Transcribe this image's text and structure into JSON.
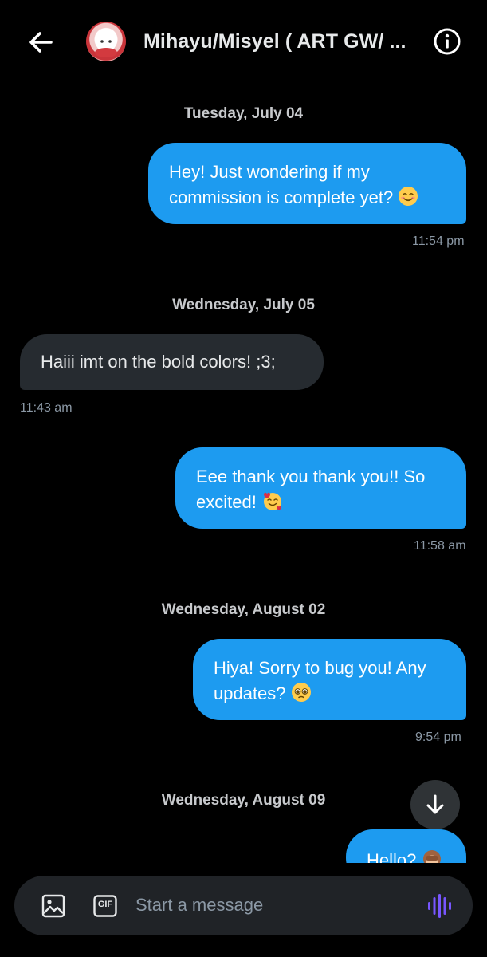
{
  "header": {
    "title": "Mihayu/Misyel ( ART GW/ ..."
  },
  "dates": {
    "d1": "Tuesday, July 04",
    "d2": "Wednesday, July 05",
    "d3": "Wednesday, August 02",
    "d4": "Wednesday, August 09"
  },
  "messages": [
    {
      "type": "sent",
      "text": "Hey! Just wondering if my commission is complete yet?",
      "emoji": "smiling-face-icon",
      "time": "11:54 pm"
    },
    {
      "type": "received",
      "text": "Haiii imt on the bold colors! ;3;",
      "time": "11:43 am"
    },
    {
      "type": "sent",
      "text": "Eee thank you thank you!! So excited!",
      "emoji": "smiling-face-with-hearts-icon",
      "time": "11:58 am"
    },
    {
      "type": "sent",
      "text": "Hiya! Sorry to bug you! Any updates?",
      "emoji": "pleading-face-icon",
      "time": "9:54 pm"
    },
    {
      "type": "sent",
      "text": "Hello?",
      "emoji": "see-no-evil-monkey-icon",
      "time": ""
    }
  ],
  "composer": {
    "placeholder": "Start a message",
    "gif_label": "GIF"
  },
  "colors": {
    "background": "#000000",
    "sent_bubble": "#1d9bf0",
    "received_bubble": "#262b30",
    "voice_accent": "#7856ff"
  }
}
